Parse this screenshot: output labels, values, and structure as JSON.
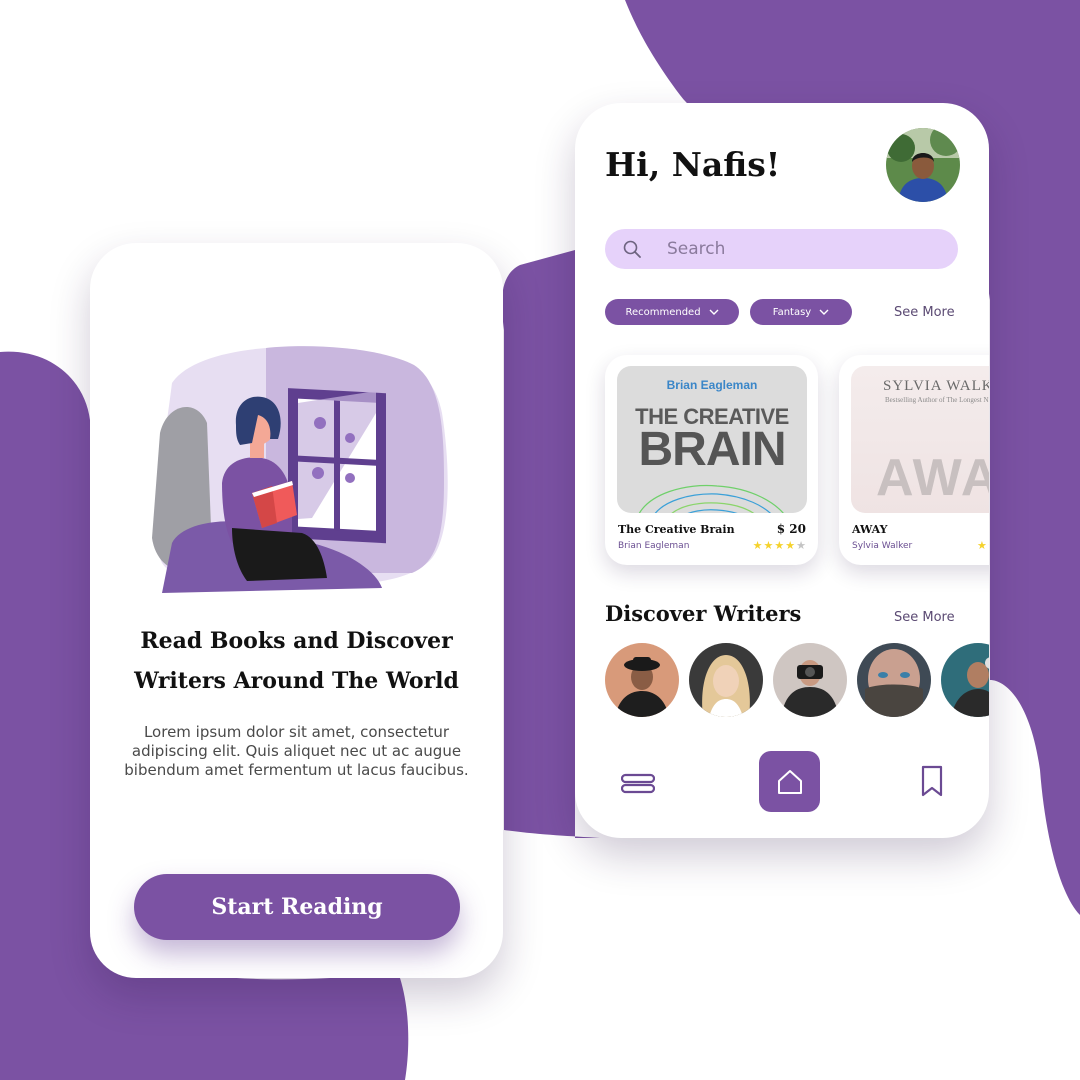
{
  "colors": {
    "accent": "#7b52a3",
    "search_bg": "#e6d2fa",
    "star_filled": "#f5d22c",
    "star_empty": "#c4c4c4"
  },
  "onboarding": {
    "title_line1": "Read Books and Discover",
    "title_line2": "Writers Around The World",
    "body": "Lorem ipsum dolor sit amet, consectetur adipiscing elit. Quis aliquet nec ut ac augue bibendum amet fermentum ut lacus faucibus.",
    "cta_label": "Start Reading"
  },
  "home": {
    "greeting": "Hi, Nafis!",
    "search": {
      "placeholder": "Search",
      "icon": "search-icon"
    },
    "filters": [
      {
        "label": "Recommended",
        "icon": "chevron-down-icon"
      },
      {
        "label": "Fantasy",
        "icon": "chevron-down-icon"
      }
    ],
    "books_see_more": "See More",
    "books": [
      {
        "title": "The Creative Brain",
        "author": "Brian Eagleman",
        "price": "$ 20",
        "rating": 4,
        "cover": {
          "author": "Brian Eagleman",
          "title_top": "THE CREATIVE",
          "title_bottom": "BRAIN"
        }
      },
      {
        "title": "AWAY",
        "author": "Sylvia Walker",
        "rating": 1,
        "cover": {
          "author": "SYLVIA WALKER",
          "tagline": "Bestselling Author of The Longest Night",
          "title": "AWAY"
        }
      }
    ],
    "writers_title": "Discover Writers",
    "writers_see_more": "See More",
    "nav": {
      "menu_icon": "menu-icon",
      "home_icon": "home-icon",
      "bookmark_icon": "bookmark-icon"
    }
  }
}
